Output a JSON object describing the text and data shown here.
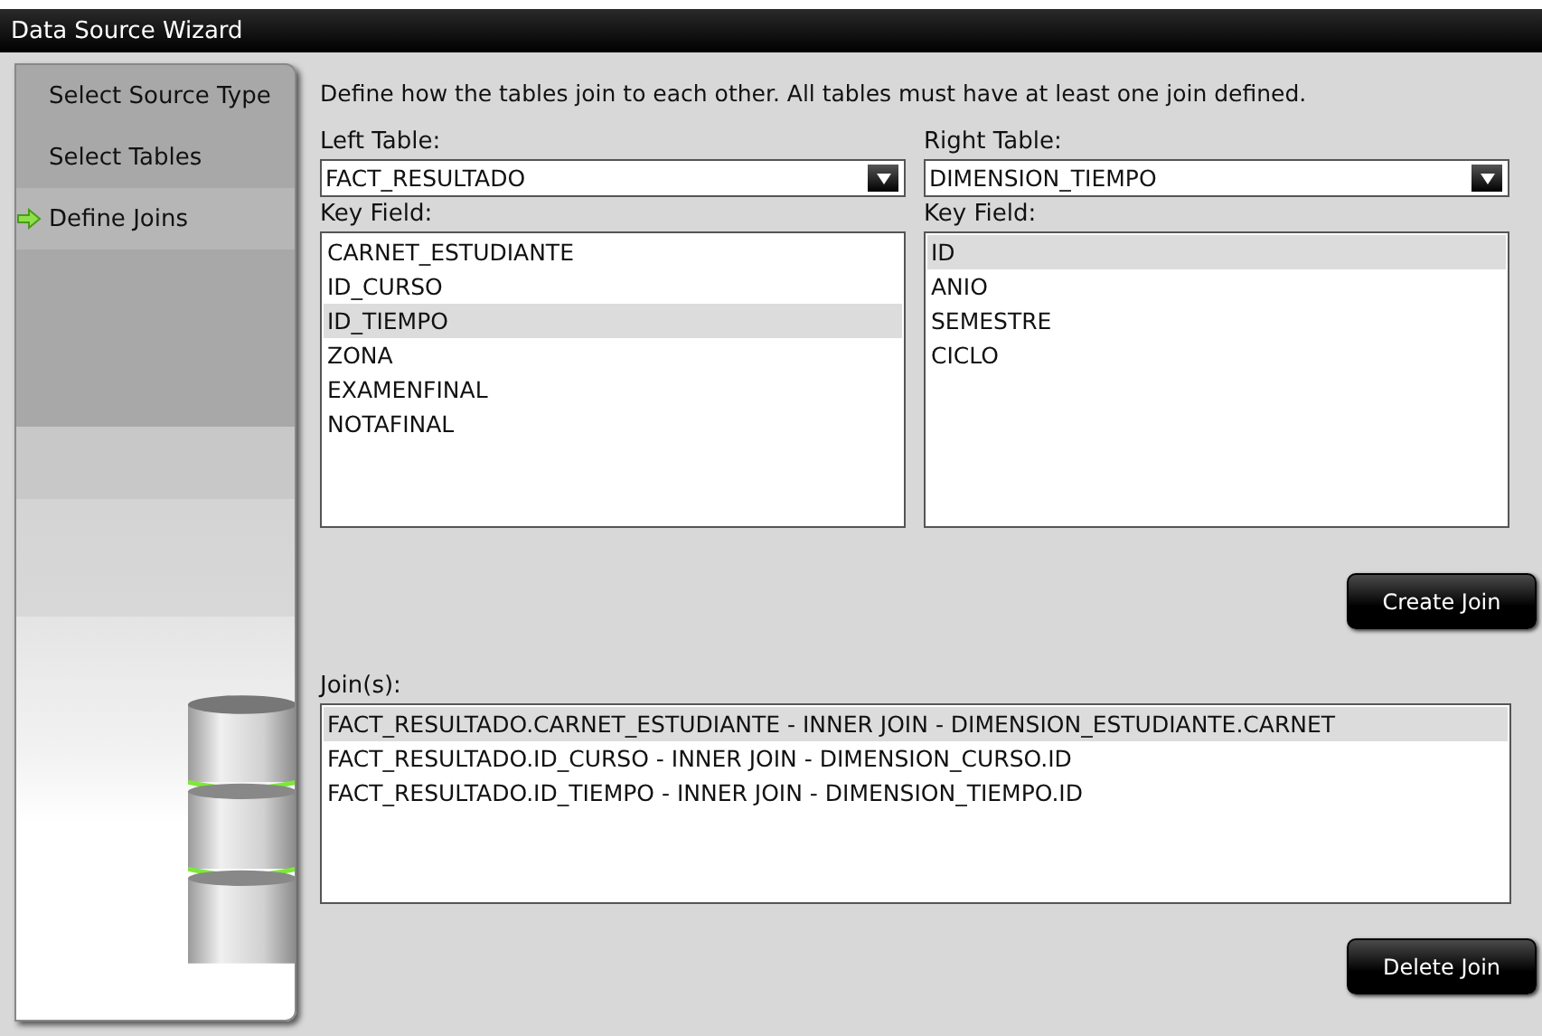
{
  "window": {
    "title": "Data Source Wizard"
  },
  "steps": [
    {
      "label": "Select Source Type",
      "current": false
    },
    {
      "label": "Select Tables",
      "current": false
    },
    {
      "label": "Define Joins",
      "current": true
    }
  ],
  "instructions": "Define how the tables join to each other. All tables must have at least one join defined.",
  "left": {
    "table_label": "Left Table:",
    "table": "FACT_RESULTADO",
    "key_label": "Key Field:",
    "fields": [
      {
        "label": "CARNET_ESTUDIANTE",
        "selected": false
      },
      {
        "label": "ID_CURSO",
        "selected": false
      },
      {
        "label": "ID_TIEMPO",
        "selected": true
      },
      {
        "label": "ZONA",
        "selected": false
      },
      {
        "label": "EXAMENFINAL",
        "selected": false
      },
      {
        "label": "NOTAFINAL",
        "selected": false
      }
    ]
  },
  "right": {
    "table_label": "Right Table:",
    "table": "DIMENSION_TIEMPO",
    "key_label": "Key Field:",
    "fields": [
      {
        "label": "ID",
        "selected": true
      },
      {
        "label": "ANIO",
        "selected": false
      },
      {
        "label": "SEMESTRE",
        "selected": false
      },
      {
        "label": "CICLO",
        "selected": false
      }
    ]
  },
  "create_button": "Create Join",
  "joins_label": "Join(s):",
  "joins": [
    {
      "label": "FACT_RESULTADO.CARNET_ESTUDIANTE - INNER JOIN - DIMENSION_ESTUDIANTE.CARNET",
      "selected": true
    },
    {
      "label": "FACT_RESULTADO.ID_CURSO - INNER JOIN - DIMENSION_CURSO.ID",
      "selected": false
    },
    {
      "label": "FACT_RESULTADO.ID_TIEMPO - INNER JOIN - DIMENSION_TIEMPO.ID",
      "selected": false
    }
  ],
  "delete_button": "Delete Join"
}
